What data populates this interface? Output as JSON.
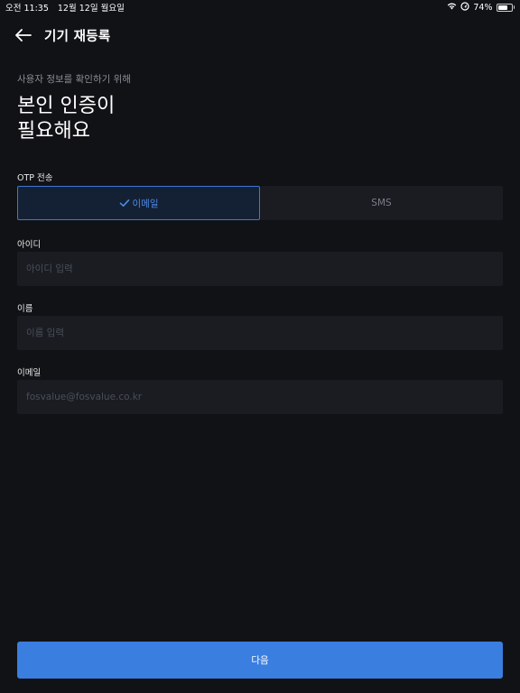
{
  "status_bar": {
    "time": "오전 11:35",
    "date": "12월 12일 월요일",
    "battery_percent": "74%",
    "battery_level": 0.74,
    "icons": [
      "wifi-icon",
      "location-icon",
      "battery-icon"
    ]
  },
  "nav": {
    "back_icon": "arrow-left-icon",
    "title": "기기 재등록"
  },
  "intro": {
    "subtitle": "사용자 정보를 확인하기 위해",
    "headline_line1": "본인 인증이",
    "headline_line2": "필요해요"
  },
  "otp": {
    "label": "OTP 전송",
    "options": [
      {
        "label": "이메일",
        "selected": true
      },
      {
        "label": "SMS",
        "selected": false
      }
    ]
  },
  "fields": {
    "id": {
      "label": "아이디",
      "placeholder": "아이디 입력",
      "value": ""
    },
    "name": {
      "label": "이름",
      "placeholder": "이름 입력",
      "value": ""
    },
    "email": {
      "label": "이메일",
      "placeholder": "fosvalue@fosvalue.co.kr",
      "value": ""
    }
  },
  "actions": {
    "next_label": "다음"
  },
  "colors": {
    "background": "#111216",
    "input_background": "#1a1c22",
    "accent": "#3a7ee0",
    "selected_border": "#3d77d2"
  }
}
